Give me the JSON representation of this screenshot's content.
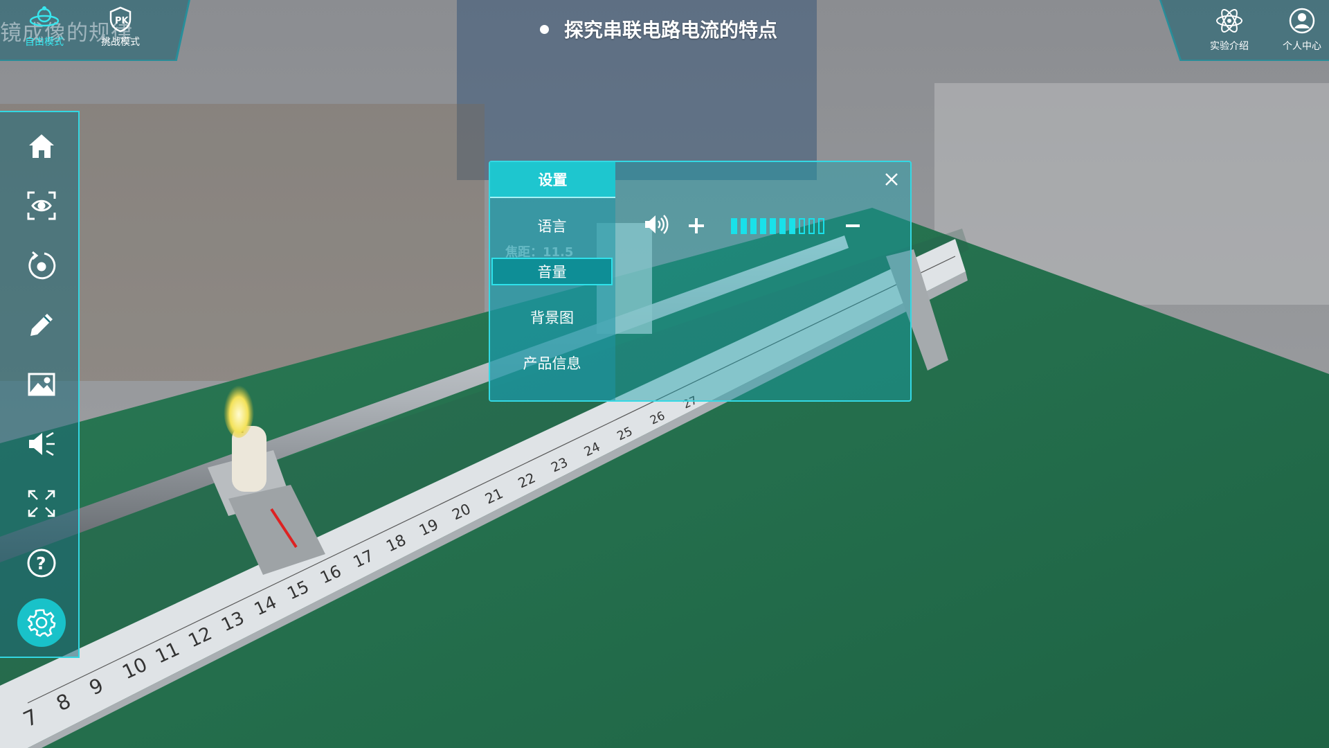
{
  "app": {
    "title": "探究串联电路电流的特点",
    "background_title": "镜成像的规律"
  },
  "mode_tabs": [
    {
      "label": "自由模式",
      "icon": "atom-orbit-icon",
      "active": true
    },
    {
      "label": "挑战模式",
      "icon": "shield-challenge-icon",
      "active": false
    }
  ],
  "top_right": [
    {
      "label": "实验介绍",
      "icon": "atom-icon"
    },
    {
      "label": "个人中心",
      "icon": "user-icon"
    }
  ],
  "toolbar": [
    {
      "icon": "home-icon"
    },
    {
      "icon": "eye-view-icon"
    },
    {
      "icon": "reset-rotate-icon"
    },
    {
      "icon": "pencil-icon"
    },
    {
      "icon": "image-icon"
    },
    {
      "icon": "speaker-mute-icon"
    },
    {
      "icon": "fullscreen-icon"
    },
    {
      "icon": "help-icon"
    },
    {
      "icon": "settings-icon",
      "active": true
    }
  ],
  "settings_dialog": {
    "title": "设置",
    "menu": [
      "语言",
      "音量",
      "背景图",
      "产品信息"
    ],
    "selected": "音量",
    "volume": {
      "level": 7,
      "max": 12
    }
  },
  "scene": {
    "focal_label": "焦距：11.5",
    "ruler_numbers": [
      "7",
      "8",
      "9",
      "10",
      "11",
      "12",
      "13",
      "14",
      "15",
      "16",
      "17",
      "18",
      "19",
      "20",
      "21",
      "22",
      "23",
      "24",
      "25",
      "26",
      "27"
    ]
  },
  "colors": {
    "accent": "#19c2c9",
    "table_green": "#236d4c"
  }
}
